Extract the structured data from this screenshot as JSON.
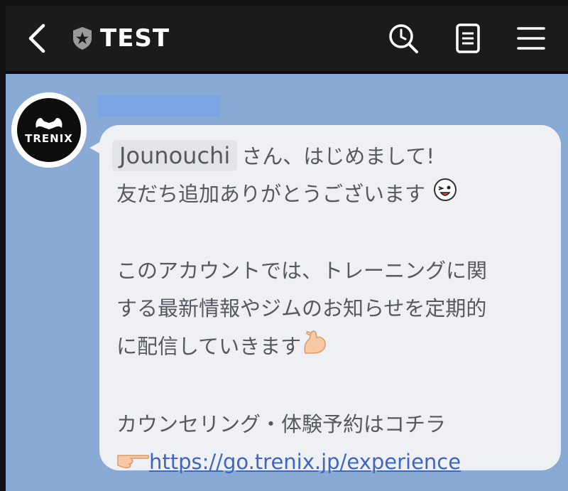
{
  "header": {
    "title": "TEST",
    "icons": {
      "back": "chevron-left-icon",
      "badge": "shield-star-icon",
      "search": "search-icon",
      "notes": "notes-icon",
      "menu": "hamburger-menu-icon"
    }
  },
  "colors": {
    "header_bg": "#1b1b1b",
    "chat_bg": "#8aaad6",
    "bubble_bg": "#eef0f3",
    "link": "#3d66c6"
  },
  "message": {
    "avatar_text": "TRENIX",
    "mention": "Jounouchi",
    "line1_rest": "さん、はじめまして!",
    "line2": "友だち追加ありがとうございます",
    "line3": "このアカウントでは、トレーニングに関",
    "line4": "する最新情報やジムのお知らせを定期的",
    "line5": "に配信していきます",
    "line6": "カウンセリング・体験予約はコチラ",
    "link_prefix": "👉",
    "link": "https://go.trenix.jp/experience",
    "emojis": [
      "winking-face-sticker-icon",
      "flexed-biceps-icon",
      "pointing-right-hand-icon"
    ]
  }
}
